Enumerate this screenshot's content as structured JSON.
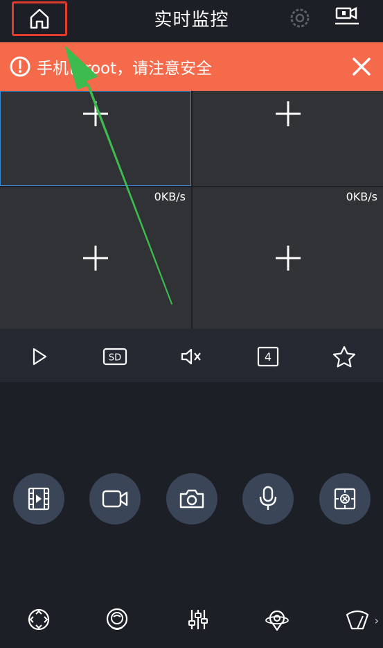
{
  "header": {
    "title": "实时监控",
    "home_icon": "home-icon",
    "settings_icon": "gear-icon",
    "camera_list_icon": "camera-list-icon"
  },
  "alert": {
    "text": "手机已root，请注意安全",
    "icon": "warning-circle-icon",
    "close_icon": "close-icon",
    "color": "#f56a4b"
  },
  "grid": {
    "cells": [
      {
        "rate": ""
      },
      {
        "rate": ""
      },
      {
        "rate": "0KB/s"
      },
      {
        "rate": "0KB/s"
      }
    ]
  },
  "controls": {
    "items": [
      "play-icon",
      "sd-quality-icon",
      "mute-icon",
      "split-4-icon",
      "favorite-star-icon"
    ],
    "sd_label": "SD",
    "split_label": "4"
  },
  "actions": {
    "items": [
      "video-playback-icon",
      "record-icon",
      "snapshot-icon",
      "microphone-icon",
      "screenshot-icon"
    ]
  },
  "bottom_bar": {
    "items": [
      "ptz-icon",
      "fisheye-icon",
      "adjust-sliders-icon",
      "location-icon",
      "wiper-icon"
    ],
    "more": "›"
  },
  "colors": {
    "background": "#1c1f25",
    "alert": "#f56a4b",
    "highlight_box": "#e53b2c",
    "annotation_arrow": "#3dbb4e",
    "round_button": "#3a4658"
  }
}
